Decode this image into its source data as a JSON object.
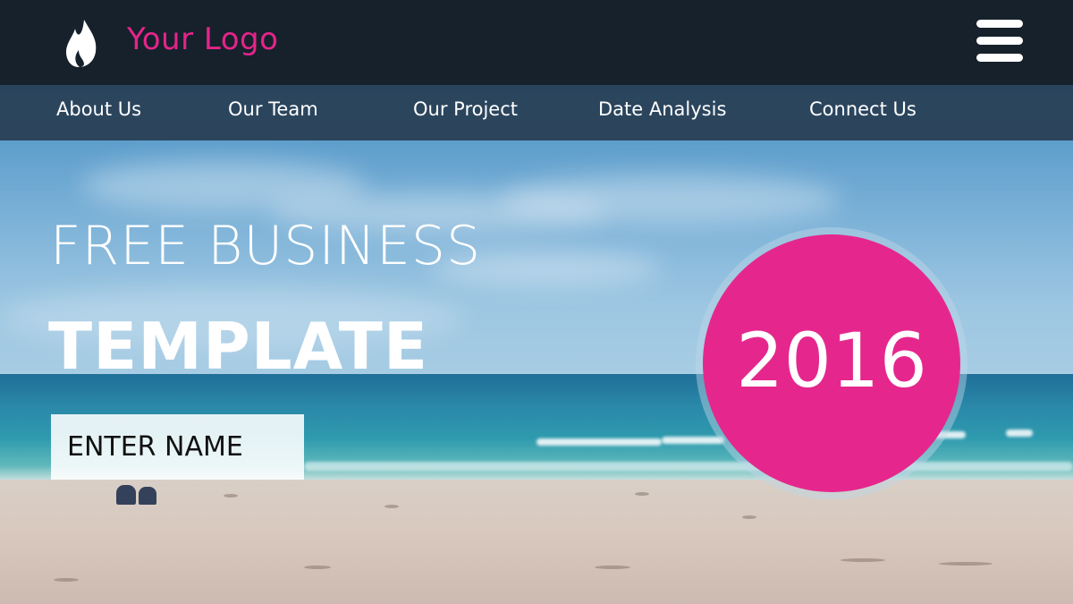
{
  "header": {
    "logo_icon": "flame-icon",
    "logo_text": "Your Logo",
    "menu_icon": "hamburger-menu-icon",
    "logo_color": "#e5248a",
    "background_color": "#16212c"
  },
  "nav": {
    "items": [
      {
        "label": "About Us"
      },
      {
        "label": "Our Team"
      },
      {
        "label": "Our Project"
      },
      {
        "label": "Date Analysis"
      },
      {
        "label": "Connect Us"
      }
    ]
  },
  "hero": {
    "line1": "FREE BUSINESS",
    "line2": "TEMPLATE",
    "name_input_placeholder": "ENTER NAME"
  },
  "badge": {
    "year": "2016",
    "color": "#e5278d"
  }
}
